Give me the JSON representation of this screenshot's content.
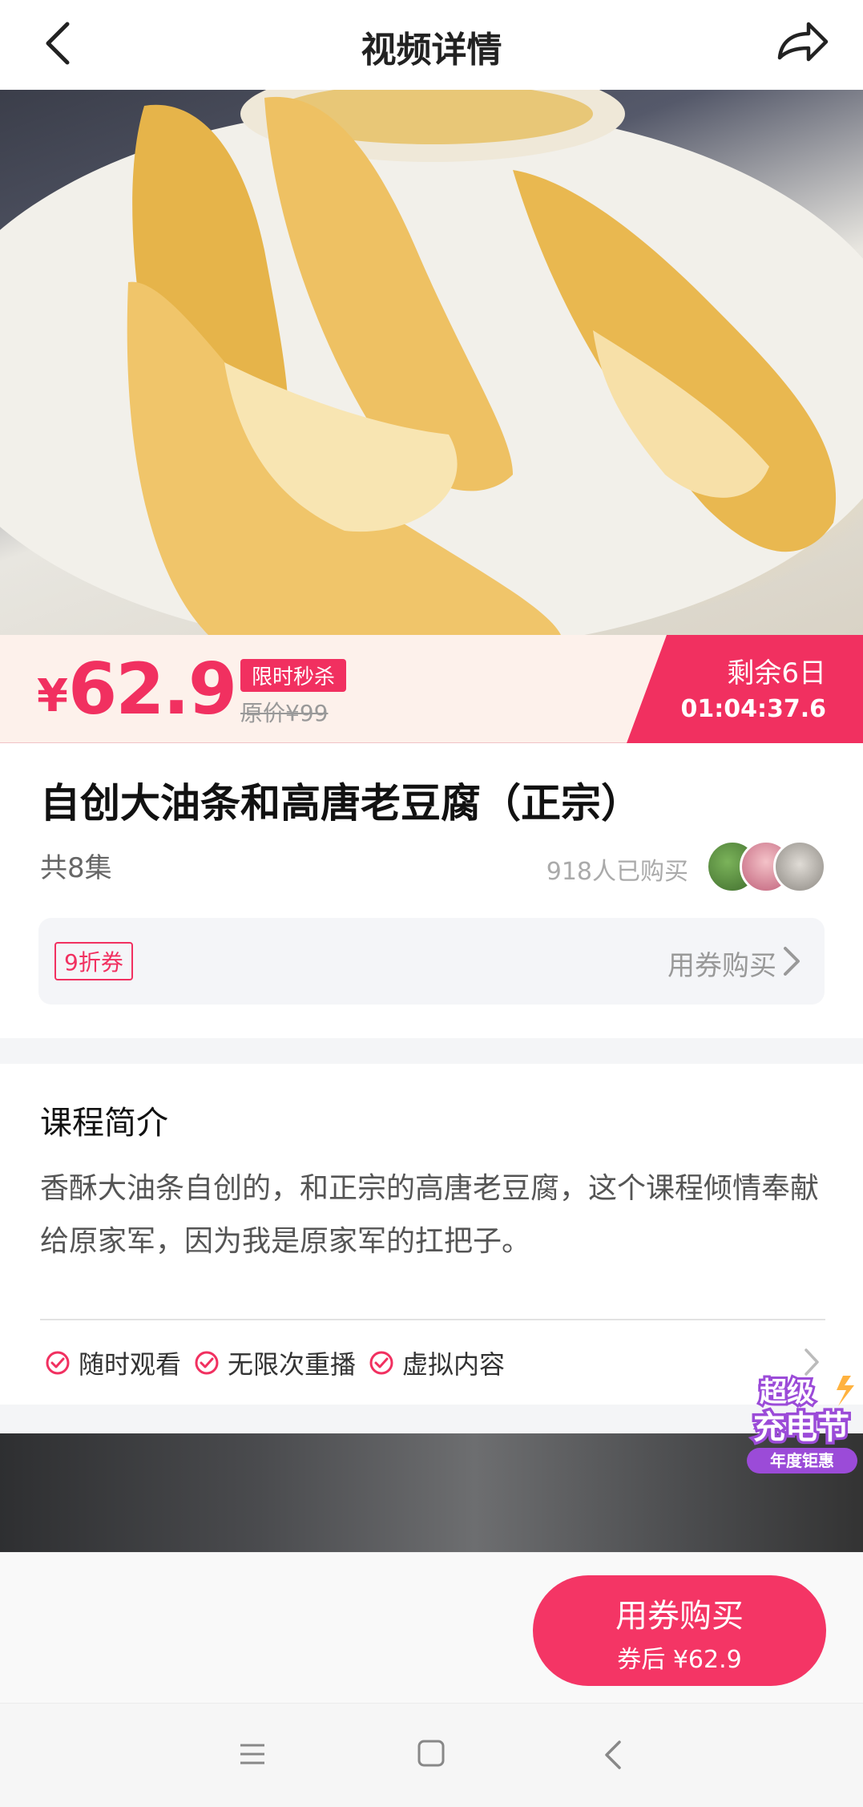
{
  "header": {
    "title": "视频详情",
    "back_icon": "chevron-left-icon",
    "share_icon": "share-arrow-icon"
  },
  "price": {
    "currency": "¥",
    "amount": "62.9",
    "flash_label": "限时秒杀",
    "original": "原价¥99",
    "countdown_days": "剩余6日",
    "countdown_time": "01:04:37.6"
  },
  "course": {
    "title": "自创大油条和高唐老豆腐（正宗）",
    "episodes": "共8集",
    "buyers": "918人已购买"
  },
  "coupon": {
    "tag": "9折券",
    "link": "用券购买"
  },
  "intro": {
    "heading": "课程简介",
    "text": "香酥大油条自创的，和正宗的高唐老豆腐，这个课程倾情奉献给原家军，因为我是原家军的扛把子。",
    "features": [
      "随时观看",
      "无限次重播",
      "虚拟内容"
    ]
  },
  "badge": {
    "line1": "超级",
    "line2": "充电节",
    "line3": "年度钜惠"
  },
  "buy_button": {
    "label": "用券购买",
    "sub": "券后 ¥62.9"
  },
  "colors": {
    "accent": "#f13060",
    "price_bg": "#fdf1eb"
  }
}
